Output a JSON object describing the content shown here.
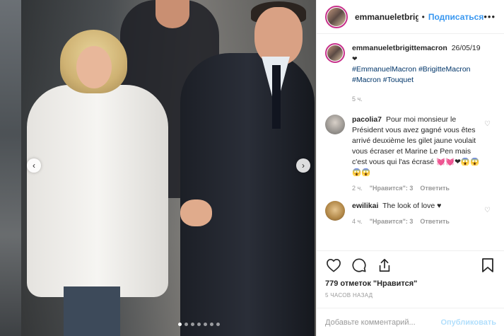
{
  "header": {
    "username": "emmanueletbrigitte",
    "separator": "•",
    "follow_label": "Подписаться",
    "more_label": "•••"
  },
  "caption": {
    "username": "emmanueletbrigittemacron",
    "text": "26/05/19",
    "emoji": "❤",
    "hashtags": [
      "#EmmanuelMacron",
      "#BrigitteMacron",
      "#Macron",
      "#Touquet"
    ],
    "time": "5 ч."
  },
  "comments": [
    {
      "username": "pacolia7",
      "text": "Pour moi monsieur le Président vous avez gagné vous êtes arrivé deuxième les gilet jaune voulait vous écraser et Marine Le Pen mais c'est vous qui l'as écrasé 💓💓❤😱😱😱😱",
      "time": "2 ч.",
      "likes": "\"Нравится\": 3",
      "reply": "Ответить"
    },
    {
      "username": "ewilikai",
      "text": "The look of love ♥",
      "time": "4 ч.",
      "likes": "\"Нравится\": 3",
      "reply": "Ответить"
    }
  ],
  "actions": {
    "likes_text": "779 отметок \"Нравится\"",
    "timestamp": "5 ЧАСОВ НАЗАД"
  },
  "add_comment": {
    "placeholder": "Добавьте комментарий...",
    "publish_label": "Опубликовать"
  },
  "colors": {
    "accent": "#3897f0",
    "link": "#003569",
    "muted": "#999999",
    "story_ring": "#c7308a"
  },
  "carousel": {
    "prev_icon": "chevron-left-icon",
    "next_icon": "chevron-right-icon",
    "slide_count": 7,
    "active_slide": 1
  }
}
